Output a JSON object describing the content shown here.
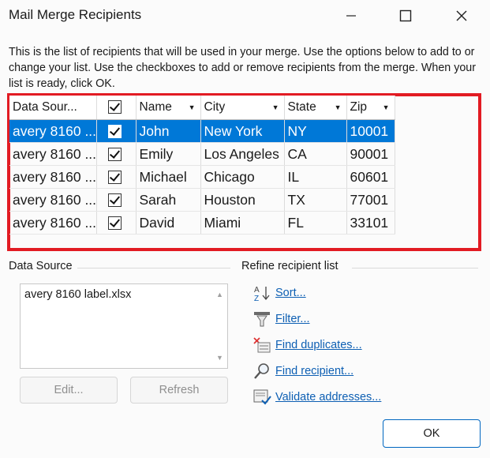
{
  "window": {
    "title": "Mail Merge Recipients"
  },
  "intro_text": "This is the list of recipients that will be used in your merge.  Use the options below to add to or change your list.  Use the checkboxes to add or remove recipients from the merge.  When your list is ready, click OK.",
  "grid": {
    "headers": [
      "Data Sour...",
      "",
      "Name",
      "City",
      "State",
      "Zip"
    ],
    "rows": [
      {
        "source": "avery 8160 ...",
        "name": "John",
        "city": "New York",
        "state": "NY",
        "zip": "10001",
        "selected": true
      },
      {
        "source": "avery 8160 ...",
        "name": "Emily",
        "city": "Los Angeles",
        "state": "CA",
        "zip": "90001"
      },
      {
        "source": "avery 8160 ...",
        "name": "Michael",
        "city": "Chicago",
        "state": "IL",
        "zip": "60601"
      },
      {
        "source": "avery 8160 ...",
        "name": "Sarah",
        "city": "Houston",
        "state": "TX",
        "zip": "77001"
      },
      {
        "source": "avery 8160 ...",
        "name": "David",
        "city": "Miami",
        "state": "FL",
        "zip": "33101"
      }
    ]
  },
  "data_source": {
    "label": "Data Source",
    "items": [
      "avery 8160 label.xlsx"
    ],
    "edit_label": "Edit...",
    "refresh_label": "Refresh"
  },
  "refine": {
    "label": "Refine recipient list",
    "links": [
      "Sort...",
      "Filter...",
      "Find duplicates...",
      "Find recipient...",
      "Validate addresses..."
    ]
  },
  "ok_label": "OK",
  "colors": {
    "selection": "#0078d7",
    "highlight_frame": "#e21b23",
    "link": "#0d5fb3"
  }
}
